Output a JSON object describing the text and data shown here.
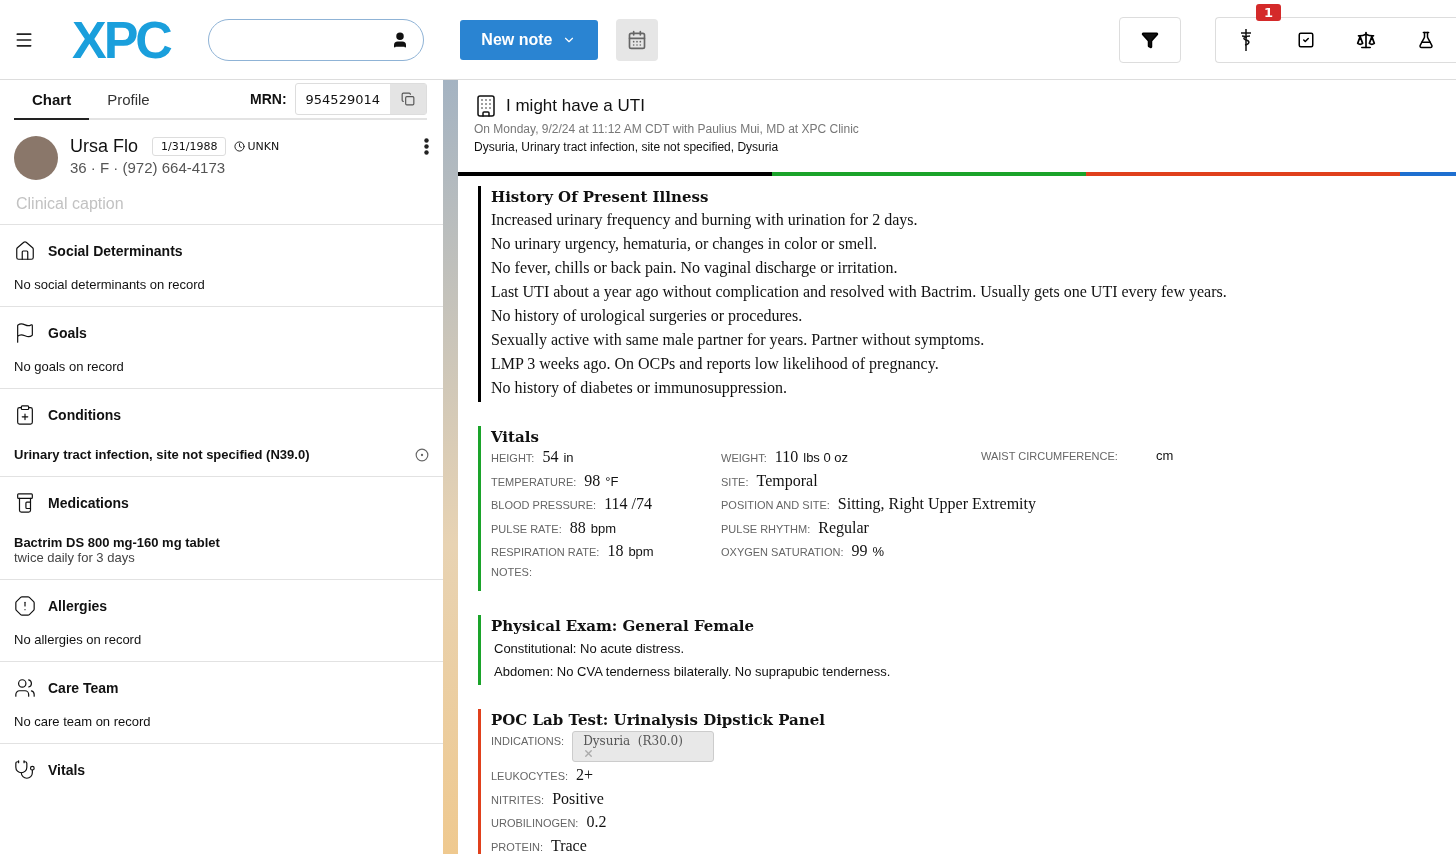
{
  "header": {
    "logo": "XPC",
    "new_note_button": "New note",
    "alerts_badge": "1"
  },
  "patient_tabs": [
    {
      "label": "Chart",
      "selected": true
    },
    {
      "label": "Profile",
      "selected": false
    }
  ],
  "mrn": {
    "label": "MRN:",
    "value": "954529014"
  },
  "patient": {
    "name": "Ursa Flo",
    "dob": "1/31/1988",
    "timezone": "UNKN",
    "details": "36 · F · (972) 664-4173",
    "caption_placeholder": "Clinical caption"
  },
  "chart_sections": [
    {
      "kind": "social",
      "title": "Social Determinants",
      "items": [
        {
          "text": "No social determinants on record",
          "kind": "empty"
        }
      ]
    },
    {
      "kind": "goals",
      "title": "Goals",
      "items": [
        {
          "text": "No goals on record",
          "kind": "empty"
        }
      ]
    },
    {
      "kind": "conditions",
      "title": "Conditions",
      "items": [
        {
          "text": "Urinary tract infection, site not specified (N39.0)",
          "kind": "condition"
        }
      ]
    },
    {
      "kind": "medications",
      "title": "Medications",
      "items": [
        {
          "text": "Bactrim DS 800 mg-160 mg tablet",
          "sub": "twice daily for 3 days",
          "kind": "medication"
        }
      ]
    },
    {
      "kind": "allergies",
      "title": "Allergies",
      "items": [
        {
          "text": "No allergies on record",
          "kind": "empty"
        }
      ]
    },
    {
      "kind": "care_team",
      "title": "Care Team",
      "items": [
        {
          "text": "No care team on record",
          "kind": "empty"
        }
      ]
    },
    {
      "kind": "vitals",
      "title": "Vitals"
    }
  ],
  "note": {
    "title": "I might have a UTI",
    "meta": "On Monday, 9/2/24 at 11:12 AM CDT with Paulius Mui, MD at XPC Clinic",
    "diagnoses": "Dysuria, Urinary tract infection, site not specified, Dysuria",
    "progress_segments": [
      {
        "color": "#000000"
      },
      {
        "color": "#1aa32a"
      },
      {
        "color": "#e0401c"
      },
      {
        "color": "#1e6fd0"
      }
    ],
    "sections": [
      {
        "kind": "text",
        "color": "#000000",
        "title": "History Of Present Illness",
        "lines": [
          "Increased urinary frequency and burning with urination for 2 days.",
          "No urinary urgency, hematuria, or changes in color or smell.",
          "No fever, chills or back pain. No vaginal discharge or irritation.",
          "Last UTI about a year ago without complication and resolved with Bactrim. Usually gets one UTI every few years.",
          "No history of urological surgeries or procedures.",
          "Sexually active with same male partner for years. Partner without symptoms.",
          "LMP 3 weeks ago. On OCPs and reports low likelihood of pregnancy.",
          "No history of diabetes or immunosuppression."
        ]
      },
      {
        "kind": "vitals",
        "color": "#1aa32a",
        "title": "Vitals",
        "columns": [
          [
            {
              "label": "HEIGHT:",
              "value": "54",
              "unit": "in"
            },
            {
              "label": "TEMPERATURE:",
              "value": "98",
              "unit": "°F"
            },
            {
              "label": "BLOOD PRESSURE:",
              "value": "114 /74"
            },
            {
              "label": "PULSE RATE:",
              "value": "88",
              "unit": "bpm"
            },
            {
              "label": "RESPIRATION RATE:",
              "value": "18",
              "unit": "bpm"
            },
            {
              "label": "NOTES:"
            }
          ],
          [
            {
              "label": "WEIGHT:",
              "value": "110",
              "unit": "lbs 0 oz"
            },
            {
              "label": "SITE:",
              "value": "Temporal"
            },
            {
              "label": "POSITION AND SITE:",
              "value": "Sitting, Right Upper Extremity"
            },
            {
              "label": "PULSE RHYTHM:",
              "value": "Regular"
            },
            {
              "label": "OXYGEN SATURATION:",
              "value": "99",
              "unit": "%"
            }
          ],
          [
            {
              "label": "WAIST CIRCUMFERENCE:",
              "unit": "cm"
            }
          ]
        ]
      },
      {
        "kind": "exam",
        "color": "#1aa32a",
        "title": "Physical Exam: General Female",
        "lines": [
          "Constitutional: No acute distress.",
          "Abdomen: No CVA tenderness bilaterally. No suprapubic tenderness."
        ]
      },
      {
        "kind": "lab",
        "color": "#e0401c",
        "title": "POC Lab Test:  Urinalysis Dipstick Panel",
        "indication_label": "INDICATIONS:",
        "indications": [
          "Dysuria  (R30.0)"
        ],
        "results": [
          {
            "label": "LEUKOCYTES:",
            "value": "2+"
          },
          {
            "label": "NITRITES:",
            "value": "Positive"
          },
          {
            "label": "UROBILINOGEN:",
            "value": "0.2"
          },
          {
            "label": "PROTEIN:",
            "value": "Trace"
          }
        ]
      }
    ]
  }
}
